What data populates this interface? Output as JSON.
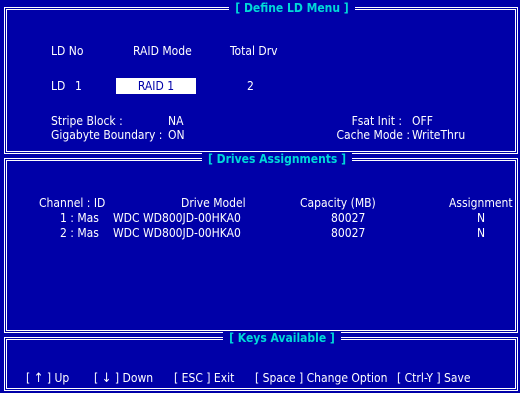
{
  "define_ld": {
    "title": "[ Define LD Menu ]",
    "col_ld_no": "LD No",
    "col_raid_mode": "RAID Mode",
    "col_total_drv": "Total Drv",
    "ld_label": "LD",
    "ld_value": "1",
    "raid_mode_value": "RAID 1",
    "total_drv_value": "2",
    "stripe_block_label": "Stripe Block :",
    "stripe_block_value": "NA",
    "gigabyte_boundary_label": "Gigabyte Boundary :",
    "gigabyte_boundary_value": "ON",
    "fast_init_label": "Fsat Init :",
    "fast_init_value": "OFF",
    "cache_mode_label": "Cache Mode :",
    "cache_mode_value": "WriteThru"
  },
  "drives": {
    "title": "[ Drives Assignments ]",
    "headers": {
      "channel_id": "Channel : ID",
      "drive_model": "Drive Model",
      "capacity": "Capacity (MB)",
      "assignment": "Assignment"
    },
    "rows": [
      {
        "channel": "1 : Mas",
        "model": "WDC  WD800JD-00HKA0",
        "capacity": "80027",
        "assignment": "N"
      },
      {
        "channel": "2 : Mas",
        "model": "WDC  WD800JD-00HKA0",
        "capacity": "80027",
        "assignment": "N"
      }
    ]
  },
  "keys": {
    "title": "[ Keys Available ]",
    "up": "Up",
    "down": "Down",
    "esc": "[ ESC ] Exit",
    "space": "[ Space ] Change Option",
    "ctrl_y": "[ Ctrl-Y ] Save"
  },
  "colors": {
    "background": "#0000a8",
    "text": "#ffffff",
    "section_title": "#00d8d8",
    "highlight_bg": "#ffffff",
    "highlight_text": "#0000a8"
  }
}
